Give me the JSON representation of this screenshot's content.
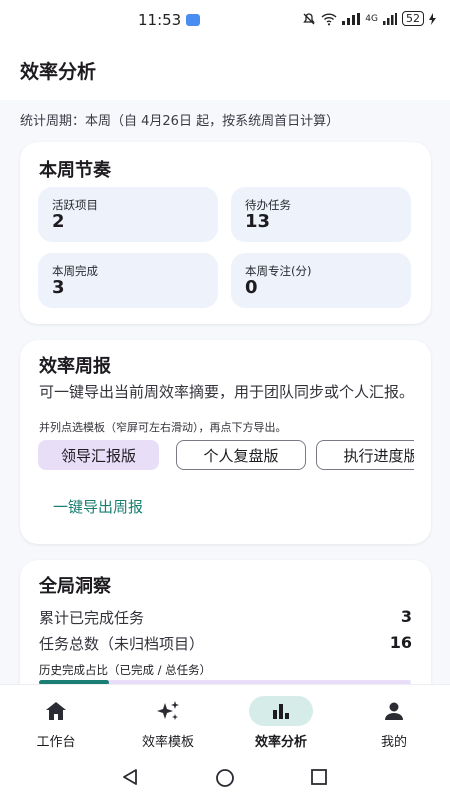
{
  "status": {
    "time": "11:53",
    "network": "4G",
    "battery": "52"
  },
  "header": {
    "title": "效率分析"
  },
  "period_text": "统计周期：本周（自 4月26日 起，按系统周首日计算）",
  "rhythm": {
    "title": "本周节奏",
    "stats": [
      {
        "label": "活跃项目",
        "value": "2"
      },
      {
        "label": "待办任务",
        "value": "13"
      },
      {
        "label": "本周完成",
        "value": "3"
      },
      {
        "label": "本周专注(分)",
        "value": "0"
      }
    ]
  },
  "report": {
    "title": "效率周报",
    "description": "可一键导出当前周效率摘要，用于团队同步或个人汇报。",
    "hint": "并列点选模板（窄屏可左右滑动），再点下方导出。",
    "templates": [
      {
        "label": "领导汇报版",
        "selected": true
      },
      {
        "label": "个人复盘版",
        "selected": false
      },
      {
        "label": "执行进度版",
        "selected": false
      }
    ],
    "export_label": "一键导出周报"
  },
  "insight": {
    "title": "全局洞察",
    "rows": [
      {
        "label": "累计已完成任务",
        "value": "3"
      },
      {
        "label": "任务总数（未归档项目）",
        "value": "16"
      }
    ],
    "history_label": "历史完成占比（已完成 / 总任务）",
    "history_ratio": 0.1875
  },
  "nav": {
    "items": [
      {
        "label": "工作台",
        "icon": "home-icon",
        "active": false
      },
      {
        "label": "效率模板",
        "icon": "sparkles-icon",
        "active": false
      },
      {
        "label": "效率分析",
        "icon": "bar-chart-icon",
        "active": true
      },
      {
        "label": "我的",
        "icon": "person-icon",
        "active": false
      }
    ]
  },
  "colors": {
    "accent": "#1a7f72",
    "chip_selected": "#e9def8",
    "tile_bg": "#eef2fa",
    "nav_active": "#d6ece8"
  }
}
